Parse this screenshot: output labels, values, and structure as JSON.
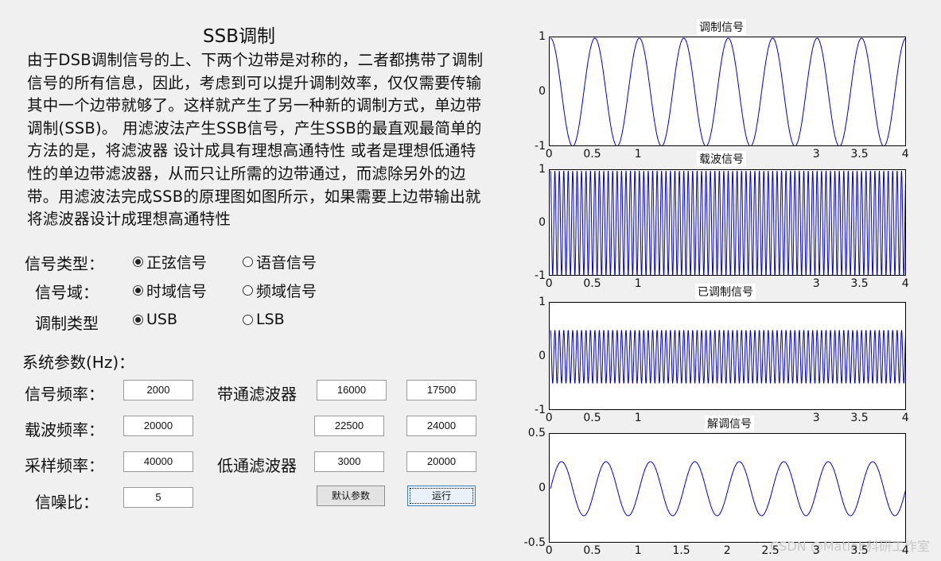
{
  "title": "SSB调制",
  "description": "由于DSB调制信号的上、下两个边带是对称的，二者都携带了调制信号的所有信息，因此，考虑到可以提升调制效率，仅仅需要传输其中一个边带就够了。这样就产生了另一种新的调制方式，单边带调制(SSB)。 用滤波法产生SSB信号，产生SSB的最直观最简单的方法的是，将滤波器 设计成具有理想高通特性 或者是理想低通特性的单边带滤波器，从而只让所需的边带通过，而滤除另外的边带。用滤波法完成SSB的原理图如图所示，如果需要上边带输出就将滤波器设计成理想高通特性",
  "radio_groups": {
    "signal_type": {
      "label": "信号类型：",
      "opt1": "正弦信号",
      "opt2": "语音信号",
      "selected": "正弦信号"
    },
    "signal_domain": {
      "label": "信号域：",
      "opt1": "时域信号",
      "opt2": "频域信号",
      "selected": "时域信号"
    },
    "mod_type": {
      "label": "调制类型",
      "opt1": "USB",
      "opt2": "LSB",
      "selected": "USB"
    }
  },
  "params": {
    "heading": "系统参数(Hz)：",
    "signal_freq_label": "信号频率：",
    "signal_freq": "2000",
    "carrier_freq_label": "载波频率：",
    "carrier_freq": "20000",
    "sample_freq_label": "采样频率：",
    "sample_freq": "40000",
    "snr_label": "信噪比：",
    "snr": "5",
    "bandpass_label": "带通滤波器",
    "bp1_low": "16000",
    "bp1_high": "17500",
    "bp2_low": "22500",
    "bp2_high": "24000",
    "lowpass_label": "低通滤波器",
    "lp_low": "3000",
    "lp_high": "20000"
  },
  "buttons": {
    "default": "默认参数",
    "run": "运行"
  },
  "plots": [
    {
      "title": "调制信号",
      "y_ticks": [
        "1",
        "0",
        "-1"
      ],
      "x_ticks": [
        "0",
        "0.5",
        "1",
        "",
        "",
        "",
        "3",
        "3.5",
        "4"
      ],
      "xlim": [
        0,
        4
      ],
      "ylim": [
        -1,
        1
      ]
    },
    {
      "title": "载波信号",
      "y_ticks": [
        "1",
        "0",
        "-1"
      ],
      "x_ticks": [
        "0",
        "0.5",
        "1",
        "",
        "",
        "",
        "3",
        "3.5",
        "4"
      ],
      "xlim": [
        0,
        4
      ],
      "ylim": [
        -1,
        1
      ]
    },
    {
      "title": "已调制信号",
      "y_ticks": [
        "1",
        "0",
        "-1"
      ],
      "x_ticks": [
        "0",
        "0.5",
        "1",
        "",
        "",
        "",
        "3",
        "3.5",
        "4"
      ],
      "xlim": [
        0,
        4
      ],
      "ylim": [
        -1,
        1
      ]
    },
    {
      "title": "解调信号",
      "y_ticks": [
        "0.5",
        "0",
        "-0.5"
      ],
      "x_ticks": [
        "0",
        "0.5",
        "1",
        "1.5",
        "2",
        "2.5",
        "3",
        "3.5",
        "4"
      ],
      "xlim": [
        0,
        4
      ],
      "ylim": [
        -0.5,
        0.5
      ]
    }
  ],
  "chart_data": [
    {
      "type": "line",
      "title": "调制信号",
      "xlim": [
        0,
        4
      ],
      "ylim": [
        -1,
        1
      ],
      "series": [
        {
          "function": "cos",
          "cycles": 8,
          "amplitude": 1
        }
      ]
    },
    {
      "type": "line",
      "title": "载波信号",
      "xlim": [
        0,
        4
      ],
      "ylim": [
        -1,
        1
      ],
      "series": [
        {
          "function": "cos",
          "cycles": 80,
          "amplitude": 1
        }
      ]
    },
    {
      "type": "line",
      "title": "已调制信号",
      "xlim": [
        0,
        4
      ],
      "ylim": [
        -1,
        1
      ],
      "series": [
        {
          "function": "cos",
          "cycles": 80,
          "amplitude": 0.5
        }
      ]
    },
    {
      "type": "line",
      "title": "解调信号",
      "xlim": [
        0,
        4
      ],
      "ylim": [
        -0.5,
        0.5
      ],
      "series": [
        {
          "function": "sin",
          "cycles": 8,
          "amplitude": 0.25
        }
      ]
    }
  ],
  "watermark": "CSDN @Matlab科研工作室",
  "line_color": "#0000cc"
}
